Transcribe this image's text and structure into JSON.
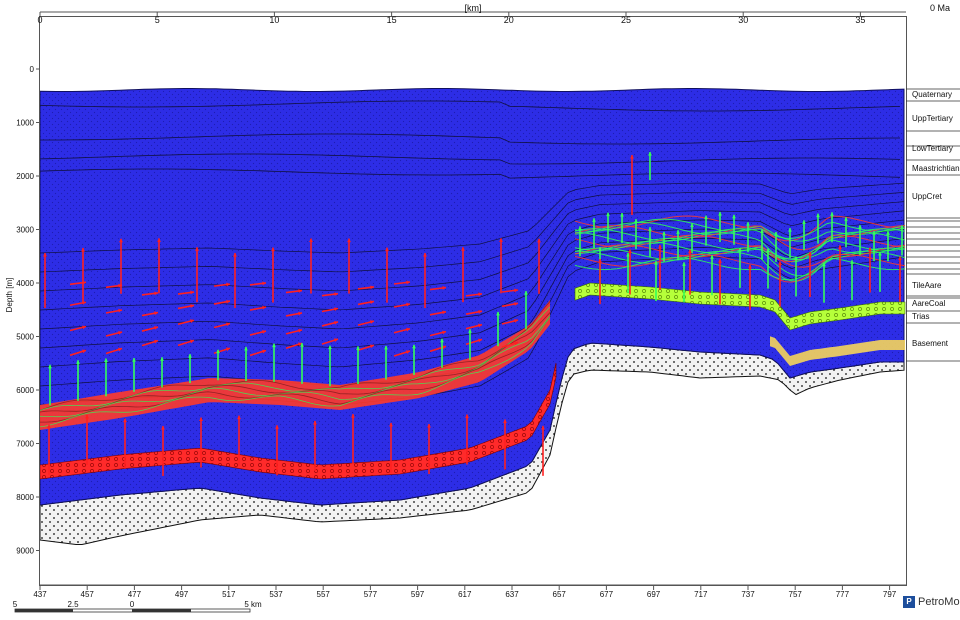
{
  "time_label": "0 Ma",
  "top_axis": {
    "unit_label": "[km]",
    "ticks": [
      "0",
      "5",
      "10",
      "15",
      "20",
      "25",
      "30",
      "35"
    ]
  },
  "left_axis": {
    "label": "Depth [m]",
    "ticks": [
      "0",
      "1000",
      "2000",
      "3000",
      "4000",
      "5000",
      "6000",
      "7000",
      "8000",
      "9000"
    ]
  },
  "bottom_axis": {
    "ticks": [
      "437",
      "457",
      "477",
      "497",
      "517",
      "537",
      "557",
      "577",
      "597",
      "617",
      "637",
      "657",
      "677",
      "697",
      "717",
      "737",
      "757",
      "777",
      "797"
    ]
  },
  "scale_bar": {
    "ticks": [
      "5",
      "2.5",
      "0",
      "5 km"
    ]
  },
  "layers": [
    "Quaternary",
    "UppTertiary",
    "LowTertiary",
    "Maastrichtian",
    "UppCret",
    "TileAare",
    "AareCoal",
    "Trias",
    "Basement"
  ],
  "brand": "PetroMod",
  "colors": {
    "sediment_blue": "#2d2de6",
    "coal_red": "#ff2a2a",
    "oil_green": "#29ff4e",
    "green_yellow": "#b6ff3a",
    "basement": "#f0f0f0"
  }
}
